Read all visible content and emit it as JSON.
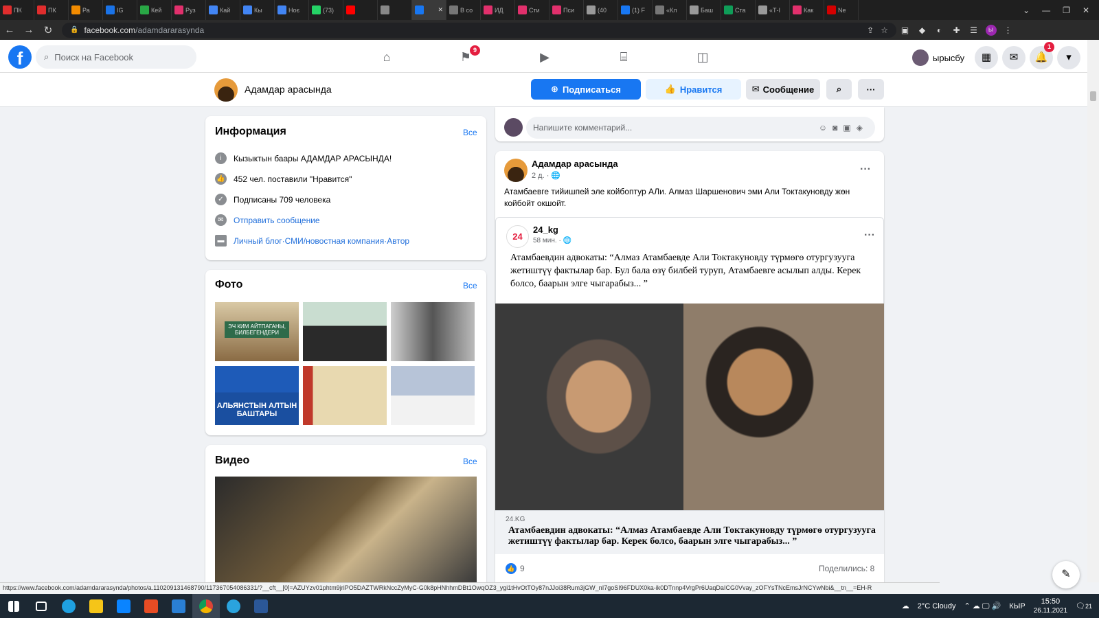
{
  "browser": {
    "tabs": [
      {
        "label": "ПК",
        "color": "#e02d2d"
      },
      {
        "label": "ПК",
        "color": "#e02d2d"
      },
      {
        "label": "Ра",
        "color": "#f28b00"
      },
      {
        "label": "IG",
        "color": "#1a73e8"
      },
      {
        "label": "Кей",
        "color": "#29a745"
      },
      {
        "label": "Руз",
        "color": "#e1306c"
      },
      {
        "label": "Кай",
        "color": "#4285f4"
      },
      {
        "label": "Кы",
        "color": "#4285f4"
      },
      {
        "label": "Ноє",
        "color": "#4285f4"
      },
      {
        "label": "(73)",
        "color": "#25d366"
      },
      {
        "label": "",
        "color": "#ff0000"
      },
      {
        "label": "",
        "color": "#888"
      },
      {
        "label": "",
        "color": "#1877f2",
        "active": true
      },
      {
        "label": "В со",
        "color": "#777"
      },
      {
        "label": "ИД",
        "color": "#e1306c"
      },
      {
        "label": "Сти",
        "color": "#e1306c"
      },
      {
        "label": "Пси",
        "color": "#e1306c"
      },
      {
        "label": "(40",
        "color": "#999"
      },
      {
        "label": "(1) F",
        "color": "#1877f2"
      },
      {
        "label": "«Кл",
        "color": "#777"
      },
      {
        "label": "Баш",
        "color": "#999"
      },
      {
        "label": "Ста",
        "color": "#0f9d58"
      },
      {
        "label": "«Т-І",
        "color": "#999"
      },
      {
        "label": "Как",
        "color": "#e1306c"
      },
      {
        "label": "Ne",
        "color": "#d40000"
      }
    ],
    "url_domain": "facebook.com",
    "url_path": "/adamdararasynda",
    "status_url": "https://www.facebook.com/adamdararasynda/photos/a.110209131468790/117367054086331/?__cft__[0]=AZUYzv01phtm9jriPO5DAZTWRkNccZyMyC-G0k8pHNhhmDBt1OwqOZ3_ygi1tHvOtTOy87nJJoi38Rum3jGW_nI7goSI96FDUX0ka-ik0DTnnp4VrgPr6UaqDaICG0Vvay_zOFYsTNcEmsJrNCYwNbi&__tn__=EH-R"
  },
  "fb": {
    "search_placeholder": "Поиск на Facebook",
    "groups_badge": "9",
    "user_name": "ырысбу",
    "notif_badge": "1",
    "colors": {
      "primary": "#1877f2",
      "bg": "#f0f2f5"
    }
  },
  "page": {
    "name": "Адамдар арасында",
    "subscribe": "Подписаться",
    "like": "Нравится",
    "message": "Сообщение"
  },
  "info": {
    "title": "Информация",
    "all": "Все",
    "about": "Кызыктын баары АДАМДАР АРАСЫНДА!",
    "likes": "452 чел. поставили \"Нравится\"",
    "followers": "Подписаны 709 человека",
    "send_message": "Отправить сообщение",
    "cat1": "Личный блог",
    "sep": " · ",
    "cat2": "СМИ/новостная компания",
    "cat3": "Автор"
  },
  "photos": {
    "title": "Фото",
    "all": "Все",
    "overlay1": "ЭЧ КИМ АЙТПАГАНЫ, БИЛБЕГЕНДЕРИ",
    "overlay4": "АЛЬЯНСТЫН АЛТЫН БАШТАРЫ"
  },
  "videos": {
    "title": "Видео",
    "all": "Все"
  },
  "comment_placeholder": "Напишите комментарий...",
  "post": {
    "author": "Адамдар арасында",
    "time": "2 д. · 🌐",
    "text": "Атамбаевге тийишпей эле койбоптур АЛи. Алмаз Шаршенович эми Али Токтакуновду жөн койбойт окшойт.",
    "shared": {
      "author": "24_kg",
      "logo": "24",
      "time": "58 мин. · 🌐",
      "text": "Атамбаевдин адвокаты: “Алмаз Атамбаевде Али Токтакуновду түрмөгө отургузууга жетиштүү фактылар бар. Бул бала өзү билбей туруп, Атамбаевге асылып алды. Керек болсо, баарын элге чыгарабыз... ”"
    },
    "link_domain": "24.KG",
    "link_title": "Атамбаевдин адвокаты: “Алмаз Атамбаевде Али Токтакуновду түрмөгө отургузууга жетиштүү фактылар бар. Керек болсо, баарын элге чыгарабыз... ”",
    "likes": "9",
    "shares": "Поделились: 8"
  },
  "taskbar": {
    "weather": "2°C Cloudy",
    "lang": "КЫР",
    "time": "15:50",
    "date": "26.11.2021",
    "notif": "21"
  }
}
